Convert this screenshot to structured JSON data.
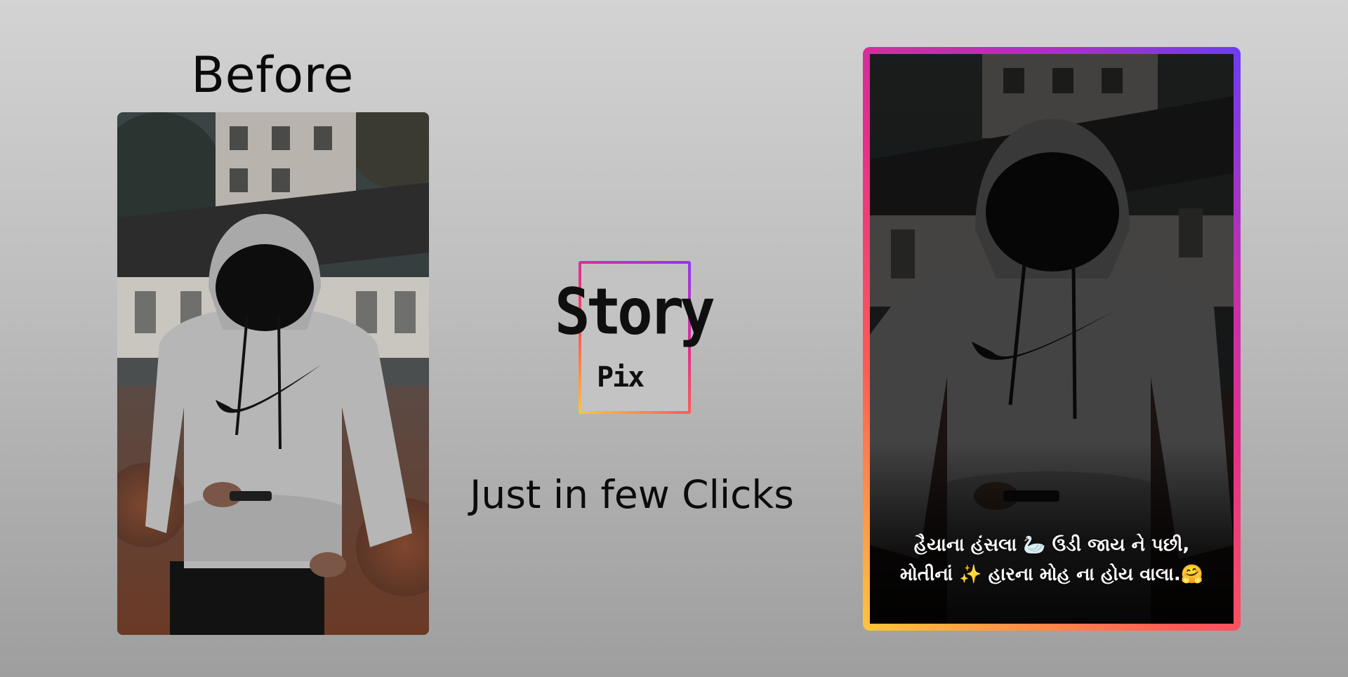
{
  "before": {
    "title": "Before"
  },
  "logo": {
    "word": "Story",
    "sub": "Pix",
    "gradient": [
      "#ffc63b",
      "#fd5b55",
      "#e52f8b",
      "#8f35f5"
    ]
  },
  "tagline": "Just in few Clicks",
  "after": {
    "caption_line1": "હૈયાના હંસલા 🦢 ઉડી જાય ને પછી,",
    "caption_line2": "મોતીનાં ✨ હારના મોહ ના હોય વાલા.🤗",
    "border_gradient": [
      "#ffc63b",
      "#fd5b55",
      "#e52f8b",
      "#6b3cf6"
    ]
  },
  "colors": {
    "background_top": "#d3d3d3",
    "background_bottom": "#9e9e9e",
    "text": "#0b0b0b"
  }
}
